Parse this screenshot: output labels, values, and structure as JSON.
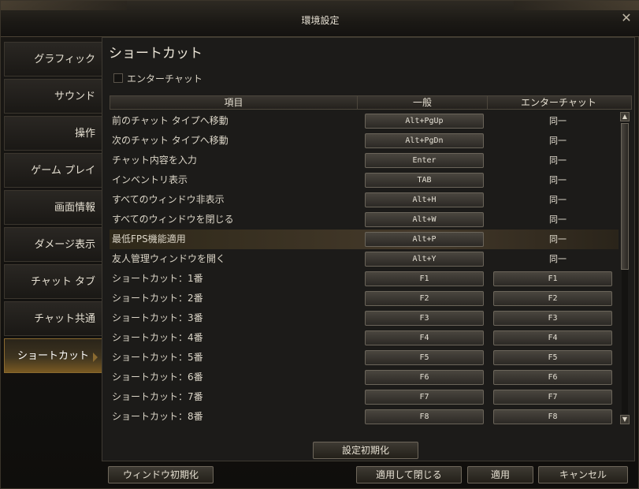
{
  "window": {
    "title": "環境設定",
    "close_glyph": "✕"
  },
  "sidebar": {
    "items": [
      {
        "label": "グラフィック"
      },
      {
        "label": "サウンド"
      },
      {
        "label": "操作"
      },
      {
        "label": "ゲーム プレイ"
      },
      {
        "label": "画面情報"
      },
      {
        "label": "ダメージ表示"
      },
      {
        "label": "チャット タブ"
      },
      {
        "label": "チャット共通"
      },
      {
        "label": "ショートカット"
      }
    ],
    "active_index": 8
  },
  "panel": {
    "title": "ショートカット",
    "enter_chat_checkbox": {
      "label": "エンターチャット",
      "checked": false
    },
    "columns": [
      "項目",
      "一般",
      "エンターチャット"
    ],
    "rows": [
      {
        "label": "前のチャット タイプへ移動",
        "general": "Alt+PgUp",
        "enter": "同一"
      },
      {
        "label": "次のチャット タイプへ移動",
        "general": "Alt+PgDn",
        "enter": "同一"
      },
      {
        "label": "チャット内容を入力",
        "general": "Enter",
        "enter": "同一"
      },
      {
        "label": "インベントリ表示",
        "general": "TAB",
        "enter": "同一"
      },
      {
        "label": "すべてのウィンドウ非表示",
        "general": "Alt+H",
        "enter": "同一"
      },
      {
        "label": "すべてのウィンドウを閉じる",
        "general": "Alt+W",
        "enter": "同一"
      },
      {
        "label": "最低FPS機能適用",
        "general": "Alt+P",
        "enter": "同一"
      },
      {
        "label": "友人管理ウィンドウを開く",
        "general": "Alt+Y",
        "enter": "同一"
      },
      {
        "label": "ショートカット：1番",
        "general": "F1",
        "enter": "F1"
      },
      {
        "label": "ショートカット：2番",
        "general": "F2",
        "enter": "F2"
      },
      {
        "label": "ショートカット：3番",
        "general": "F3",
        "enter": "F3"
      },
      {
        "label": "ショートカット：4番",
        "general": "F4",
        "enter": "F4"
      },
      {
        "label": "ショートカット：5番",
        "general": "F5",
        "enter": "F5"
      },
      {
        "label": "ショートカット：6番",
        "general": "F6",
        "enter": "F6"
      },
      {
        "label": "ショートカット：7番",
        "general": "F7",
        "enter": "F7"
      },
      {
        "label": "ショートカット：8番",
        "general": "F8",
        "enter": "F8"
      }
    ],
    "highlighted_row": 6,
    "reset_button": "設定初期化"
  },
  "footer": {
    "window_reset": "ウィンドウ初期化",
    "apply_close": "適用して閉じる",
    "apply": "適用",
    "cancel": "キャンセル"
  },
  "icons": {
    "scroll_up": "scroll-up-arrow-icon",
    "scroll_down": "scroll-down-arrow-icon",
    "close": "close-icon"
  },
  "colors": {
    "accent": "#8a6a30",
    "background": "#1c1b19"
  }
}
